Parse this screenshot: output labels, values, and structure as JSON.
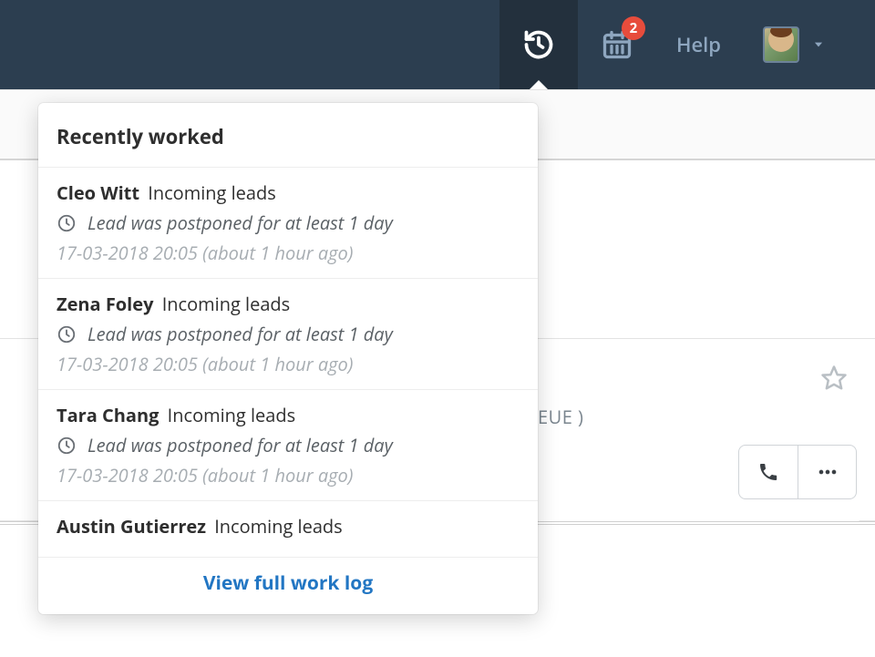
{
  "header": {
    "calendar_badge": "2",
    "help_label": "Help"
  },
  "background": {
    "queue_fragment": "EUE )"
  },
  "dropdown": {
    "title": "Recently worked",
    "footer_link": "View full work log",
    "items": [
      {
        "name": "Cleo Witt",
        "category": "Incoming leads",
        "message": "Lead was postponed for at least 1 day",
        "timestamp": "17-03-2018 20:05 (about 1 hour ago)"
      },
      {
        "name": "Zena Foley",
        "category": "Incoming leads",
        "message": "Lead was postponed for at least 1 day",
        "timestamp": "17-03-2018 20:05 (about 1 hour ago)"
      },
      {
        "name": "Tara Chang",
        "category": "Incoming leads",
        "message": "Lead was postponed for at least 1 day",
        "timestamp": "17-03-2018 20:05 (about 1 hour ago)"
      },
      {
        "name": "Austin Gutierrez",
        "category": "Incoming leads",
        "message": "",
        "timestamp": ""
      }
    ]
  }
}
